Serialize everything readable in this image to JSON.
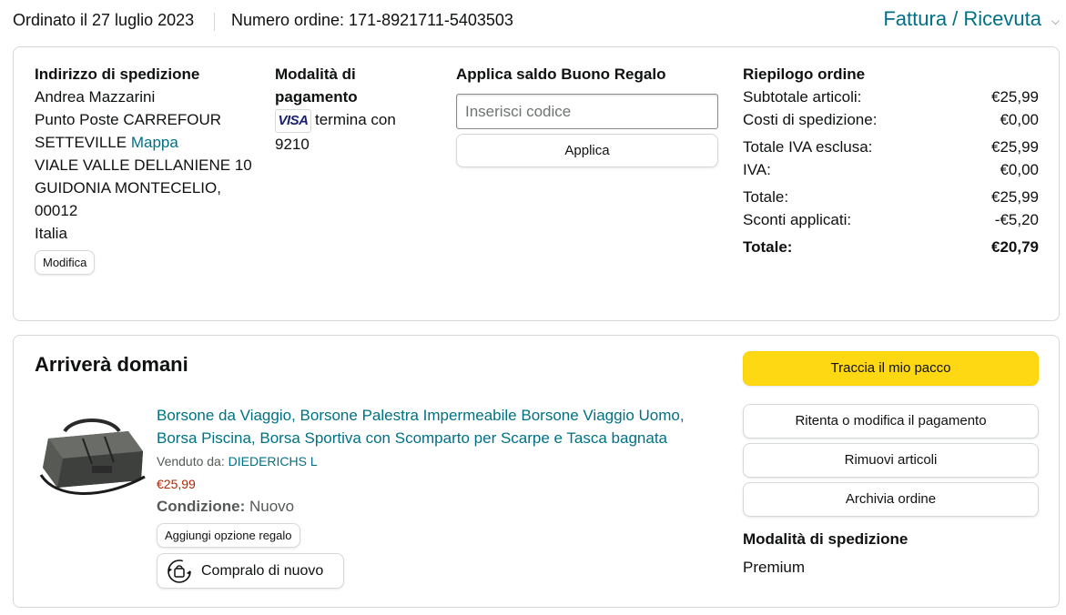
{
  "header": {
    "ordered": "Ordinato il 27 luglio 2023",
    "order_number": "Numero ordine: 171-8921711-5403503",
    "invoice": "Fattura / Ricevuta"
  },
  "shipping_address": {
    "title": "Indirizzo di spedizione",
    "name": "Andrea Mazzarini",
    "line1": "Punto Poste CARREFOUR",
    "line2": "SETTEVILLE",
    "map_link": "Mappa",
    "line3": "VIALE VALLE DELLANIENE 10",
    "line4": "GUIDONIA MONTECELIO,",
    "line5": "00012",
    "country": "Italia",
    "edit_label": "Modifica"
  },
  "payment": {
    "title": "Modalità di pagamento",
    "card_brand": "VISA",
    "card_text": "termina con",
    "card_last4": "9210"
  },
  "gift": {
    "title": "Applica saldo Buono Regalo",
    "placeholder": "Inserisci codice",
    "apply_label": "Applica"
  },
  "summary": {
    "title": "Riepilogo ordine",
    "rows": [
      {
        "label": "Subtotale articoli:",
        "value": "€25,99"
      },
      {
        "label": "Costi di spedizione:",
        "value": "€0,00"
      },
      {
        "label": "Totale IVA esclusa:",
        "value": "€25,99"
      },
      {
        "label": "IVA:",
        "value": "€0,00"
      },
      {
        "label": "Totale:",
        "value": "€25,99"
      },
      {
        "label": "Sconti applicati:",
        "value": "-€5,20"
      }
    ],
    "total_label": "Totale:",
    "total_value": "€20,79"
  },
  "shipment": {
    "status": "Arriverà domani",
    "product": {
      "title_line1": "Borsone da Viaggio, Borsone Palestra Impermeabile Borsone Viaggio Uomo,",
      "title_line2": "Borsa Piscina, Borsa Sportiva con Scomparto per Scarpe e Tasca bagnata",
      "sold_by_label": "Venduto da:",
      "seller": "DIEDERICHS L",
      "price": "€25,99",
      "condition_label": "Condizione:",
      "condition_value": "Nuovo",
      "gift_option_label": "Aggiungi opzione regalo",
      "buy_again_label": "Compralo di nuovo"
    },
    "actions": {
      "track": "Traccia il mio pacco",
      "retry_payment": "Ritenta o modifica il pagamento",
      "remove_items": "Rimuovi articoli",
      "archive": "Archivia ordine"
    },
    "shipping_method_label": "Modalità di spedizione",
    "shipping_method_value": "Premium"
  }
}
